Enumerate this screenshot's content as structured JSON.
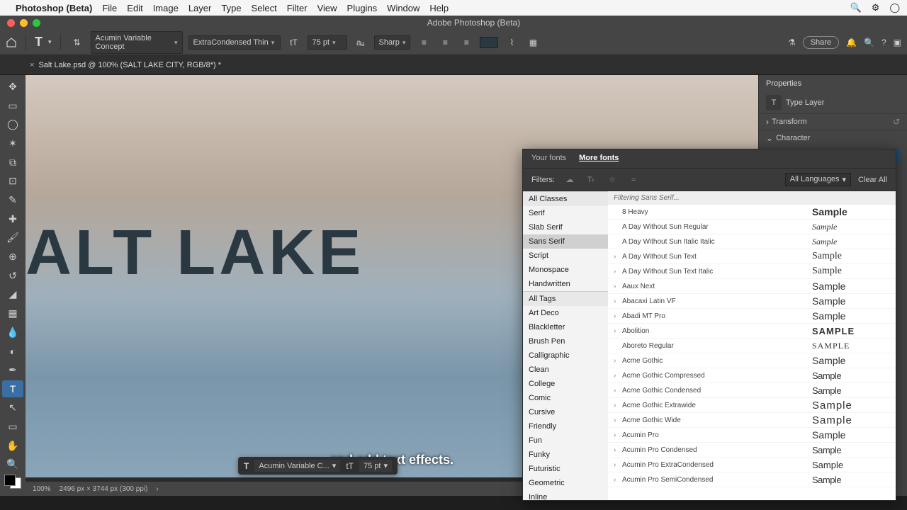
{
  "mac_menu": {
    "app": "Photoshop (Beta)",
    "items": [
      "File",
      "Edit",
      "Image",
      "Layer",
      "Type",
      "Select",
      "Filter",
      "View",
      "Plugins",
      "Window",
      "Help"
    ]
  },
  "window_title": "Adobe Photoshop (Beta)",
  "options": {
    "font_family": "Acumin Variable Concept",
    "font_style": "ExtraCondensed Thin",
    "font_size": "75 pt",
    "anti_alias": "Sharp",
    "share_label": "Share"
  },
  "doc_tab": "Salt Lake.psd @ 100% (SALT LAKE CITY, RGB/8*) *",
  "canvas_text": "ALT LAKE",
  "caption": "and add text effects.",
  "context_bar": {
    "font": "Acumin Variable C...",
    "size": "75 pt"
  },
  "status": {
    "zoom": "100%",
    "info": "2496 px × 3744 px (300 ppi)"
  },
  "props": {
    "title": "Properties",
    "layer_type": "Type Layer",
    "transform": "Transform",
    "character": "Character",
    "font": "Acumin Variable Concept"
  },
  "font_panel": {
    "tabs": {
      "your": "Your fonts",
      "more": "More fonts"
    },
    "filters_label": "Filters:",
    "lang": "All Languages",
    "clear": "Clear All",
    "status": "Filtering Sans Serif...",
    "classes_header": "All Classes",
    "classes": [
      "Serif",
      "Slab Serif",
      "Sans Serif",
      "Script",
      "Monospace",
      "Handwritten"
    ],
    "selected_class": "Sans Serif",
    "tags_header": "All Tags",
    "tags": [
      "Art Deco",
      "Blackletter",
      "Brush Pen",
      "Calligraphic",
      "Clean",
      "College",
      "Comic",
      "Cursive",
      "Friendly",
      "Fun",
      "Funky",
      "Futuristic",
      "Geometric",
      "Inline"
    ],
    "fonts": [
      {
        "exp": false,
        "name": "8 Heavy",
        "sample": "Sample",
        "cls": "s-heavy"
      },
      {
        "exp": false,
        "name": "A Day Without Sun Regular",
        "sample": "Sample",
        "cls": "s-script"
      },
      {
        "exp": false,
        "name": "A Day Without Sun Italic Italic",
        "sample": "Sample",
        "cls": "s-script"
      },
      {
        "exp": true,
        "name": "A Day Without Sun Text",
        "sample": "Sample",
        "cls": "s-regular"
      },
      {
        "exp": true,
        "name": "A Day Without Sun Text Italic",
        "sample": "Sample",
        "cls": "s-regular"
      },
      {
        "exp": true,
        "name": "Aaux Next",
        "sample": "Sample",
        "cls": "s-sans"
      },
      {
        "exp": true,
        "name": "Abacaxi Latin VF",
        "sample": "Sample",
        "cls": "s-sans"
      },
      {
        "exp": true,
        "name": "Abadi MT Pro",
        "sample": "Sample",
        "cls": "s-sans"
      },
      {
        "exp": true,
        "name": "Abolition",
        "sample": "SAMPLE",
        "cls": "s-bold"
      },
      {
        "exp": false,
        "name": "Aboreto Regular",
        "sample": "SAMPLE",
        "cls": "s-caps"
      },
      {
        "exp": true,
        "name": "Acme Gothic",
        "sample": "Sample",
        "cls": "s-sans"
      },
      {
        "exp": true,
        "name": "Acme Gothic Compressed",
        "sample": "Sample",
        "cls": "s-cond"
      },
      {
        "exp": true,
        "name": "Acme Gothic Condensed",
        "sample": "Sample",
        "cls": "s-cond"
      },
      {
        "exp": true,
        "name": "Acme Gothic Extrawide",
        "sample": "Sample",
        "cls": "s-wide"
      },
      {
        "exp": true,
        "name": "Acme Gothic Wide",
        "sample": "Sample",
        "cls": "s-wide"
      },
      {
        "exp": true,
        "name": "Acumin Pro",
        "sample": "Sample",
        "cls": "s-sans"
      },
      {
        "exp": true,
        "name": "Acumin Pro Condensed",
        "sample": "Sample",
        "cls": "s-cond"
      },
      {
        "exp": true,
        "name": "Acumin Pro ExtraCondensed",
        "sample": "Sample",
        "cls": "s-thin"
      },
      {
        "exp": true,
        "name": "Acumin Pro SemiCondensed",
        "sample": "Sample",
        "cls": "s-cond"
      }
    ]
  }
}
